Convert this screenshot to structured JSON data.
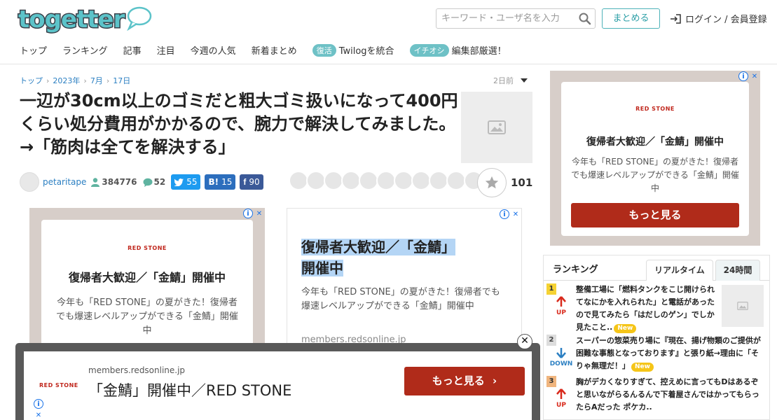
{
  "header": {
    "logo_text": "togetter",
    "search_placeholder": "キーワード・ユーザ名を入力",
    "matome_label": "まとめる",
    "login_label": "ログイン / 会員登録"
  },
  "nav": {
    "items": [
      "トップ",
      "ランキング",
      "記事",
      "注目",
      "今週の人気",
      "新着まとめ"
    ],
    "badge1": "復活",
    "badge1_text": "Twilogを統合",
    "badge2": "イチオシ",
    "badge2_text": "編集部厳選！"
  },
  "breadcrumb": {
    "items": [
      "トップ",
      "2023年",
      "7月",
      "17日"
    ],
    "ago": "2日前"
  },
  "article": {
    "title": "一辺が30cm以上のゴミだと粗大ゴミ扱いになって400円くらい処分費用がかかるので、腕力で解決してみました。→「筋肉は全てを解決する」",
    "author": "petaritape",
    "views": "384776",
    "comments": "52",
    "twitter_count": "55",
    "hatena_label": "B!",
    "hatena_count": "15",
    "facebook_count": "90",
    "favorites": "101"
  },
  "ads": {
    "brand": "RED STONE",
    "headline": "復帰者大歓迎／「金鯖」開催中",
    "headline_part1": "復帰者大歓迎／「金鯖」",
    "headline_part2": "開催中",
    "body": "今年も「RED STONE」の夏がきた！復帰者でも爆速レベルアップができる「金鯖」開催中",
    "url": "members.redsonline.jp",
    "more_label": "もっと見る",
    "anchor_headline": "「金鯖」開催中／RED STONE",
    "close_label": "✕"
  },
  "ranking": {
    "title": "ランキング",
    "tab_active": "リアルタイム",
    "tab_inactive": "24時間",
    "new_label": "New",
    "items": [
      {
        "num": "1",
        "trend": "UP",
        "text": "整備工場に「燃料タンクをこじ開けられてなにかを入れられた」と電話があったので見てみたら「はだしのゲン」でしか見たこと.."
      },
      {
        "num": "2",
        "trend": "DOWN",
        "text": "スーパーの惣菜売り場に『現在、揚げ物類のご提供が困難な事態となっております』と張り紙→理由に「そりゃ無理だ！」"
      },
      {
        "num": "3",
        "trend": "UP",
        "text": "胸がデカくなりすぎて、控えめに言ってもDはあるぞと思いながらるんるんで下着屋さんではかってもらったらAだった ポケカ.."
      }
    ]
  },
  "colors": {
    "brand_teal": "#5cc3c9",
    "ad_red": "#b02b1a",
    "link_blue": "#2b7fc2"
  }
}
